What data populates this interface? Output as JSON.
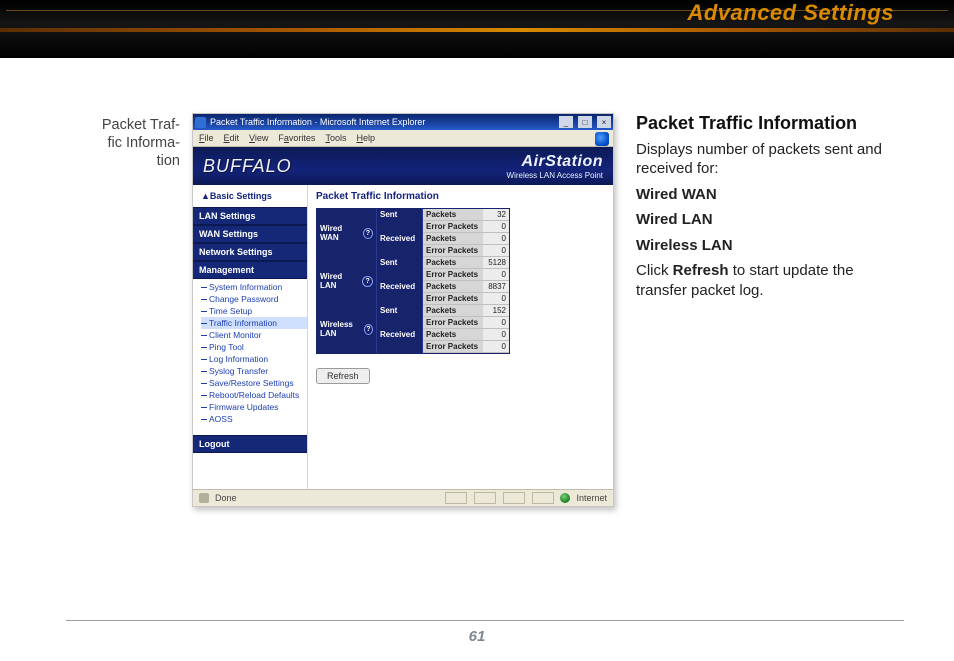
{
  "banner": {
    "title": "Advanced Settings"
  },
  "page_number": "61",
  "margin_label": "Packet Traf-\nfic Informa-\ntion",
  "right": {
    "heading": "Packet Traffic Information",
    "p1": "Displays number of packets sent and received for:",
    "b1": "Wired WAN",
    "b2": "Wired LAN",
    "b3": "Wireless LAN",
    "p2a": "Click ",
    "p2b": "Refresh",
    "p2c": " to start update the transfer packet log."
  },
  "ie": {
    "title": "Packet Traffic Information · Microsoft Internet Explorer",
    "menus": {
      "file": {
        "ul": "F",
        "rest": "ile"
      },
      "edit": {
        "ul": "E",
        "rest": "dit"
      },
      "view": {
        "ul": "V",
        "rest": "iew"
      },
      "favorites": {
        "ul": "a",
        "pre": "F",
        "rest": "vorites"
      },
      "tools": {
        "ul": "T",
        "rest": "ools"
      },
      "help": {
        "ul": "H",
        "rest": "elp"
      }
    },
    "done": "Done",
    "zone": "Internet"
  },
  "app": {
    "logo": "BUFFALO",
    "brand_big": "AirStation",
    "brand_small": "Wireless LAN Access Point",
    "basic": "▲Basic Settings",
    "nav": {
      "lan": "LAN Settings",
      "wan": "WAN Settings",
      "net": "Network Settings",
      "mgmt": "Management",
      "items": [
        "System Information",
        "Change Password",
        "Time Setup",
        "Traffic Information",
        "Client Monitor",
        "Ping Tool",
        "Log Information",
        "Syslog Transfer",
        "Save/Restore Settings",
        "Reboot/Reload Defaults",
        "Firmware Updates",
        "AOSS"
      ],
      "logout": "Logout"
    },
    "panel_title": "Packet Traffic Information",
    "labels": {
      "packets": "Packets",
      "errors": "Error Packets",
      "sent": "Sent",
      "recv": "Received",
      "wwan": "Wired WAN",
      "wlan": "Wired LAN",
      "wlss": "Wireless LAN"
    },
    "data": {
      "wwan_sent_pk": "32",
      "wwan_sent_er": "0",
      "wwan_recv_pk": "0",
      "wwan_recv_er": "0",
      "wlan_sent_pk": "5128",
      "wlan_sent_er": "0",
      "wlan_recv_pk": "8837",
      "wlan_recv_er": "0",
      "wlss_sent_pk": "152",
      "wlss_sent_er": "0",
      "wlss_recv_pk": "0",
      "wlss_recv_er": "0"
    },
    "refresh": "Refresh"
  }
}
